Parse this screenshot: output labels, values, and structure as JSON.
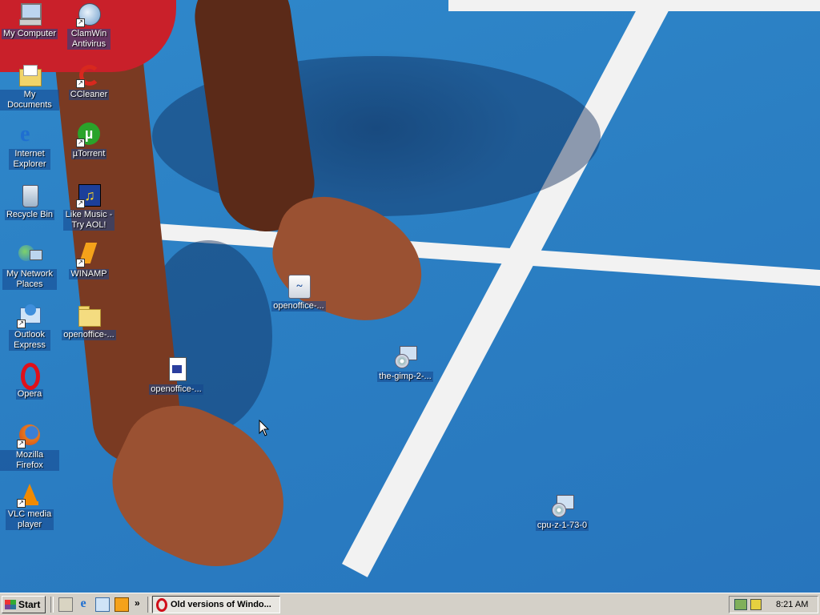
{
  "desktop": {
    "icons": [
      {
        "label": "My Computer",
        "icon": "my-computer-icon"
      },
      {
        "label": "My Documents",
        "icon": "my-documents-icon"
      },
      {
        "label": "Internet Explorer",
        "icon": "internet-explorer-icon"
      },
      {
        "label": "Recycle Bin",
        "icon": "recycle-bin-icon"
      },
      {
        "label": "My Network Places",
        "icon": "network-places-icon"
      },
      {
        "label": "Outlook Express",
        "icon": "outlook-express-icon"
      },
      {
        "label": "Opera",
        "icon": "opera-icon"
      },
      {
        "label": "Mozilla Firefox",
        "icon": "firefox-icon"
      },
      {
        "label": "VLC media player",
        "icon": "vlc-icon"
      },
      {
        "label": "ClamWin Antivirus",
        "icon": "clamwin-icon"
      },
      {
        "label": "CCleaner",
        "icon": "ccleaner-icon"
      },
      {
        "label": "µTorrent",
        "icon": "utorrent-icon"
      },
      {
        "label": "Like Music - Try AOL!",
        "icon": "aol-music-icon"
      },
      {
        "label": "WINAMP",
        "icon": "winamp-icon"
      },
      {
        "label": "openoffice-...",
        "icon": "folder-icon"
      },
      {
        "label": "openoffice-...",
        "icon": "openoffice-icon"
      },
      {
        "label": "openoffice-...",
        "icon": "document-icon"
      },
      {
        "label": "the-gimp-2-...",
        "icon": "installer-icon"
      },
      {
        "label": "cpu-z-1-73-0",
        "icon": "installer-icon"
      }
    ]
  },
  "taskbar": {
    "start_label": "Start",
    "task_title": "Old versions of Windo...",
    "quick_launch_more": "»",
    "clock": "8:21 AM"
  },
  "colors": {
    "track_blue": "#2b7fc3",
    "lane_white": "#f2f2f2",
    "taskbar_gray": "#d4d0c8"
  }
}
